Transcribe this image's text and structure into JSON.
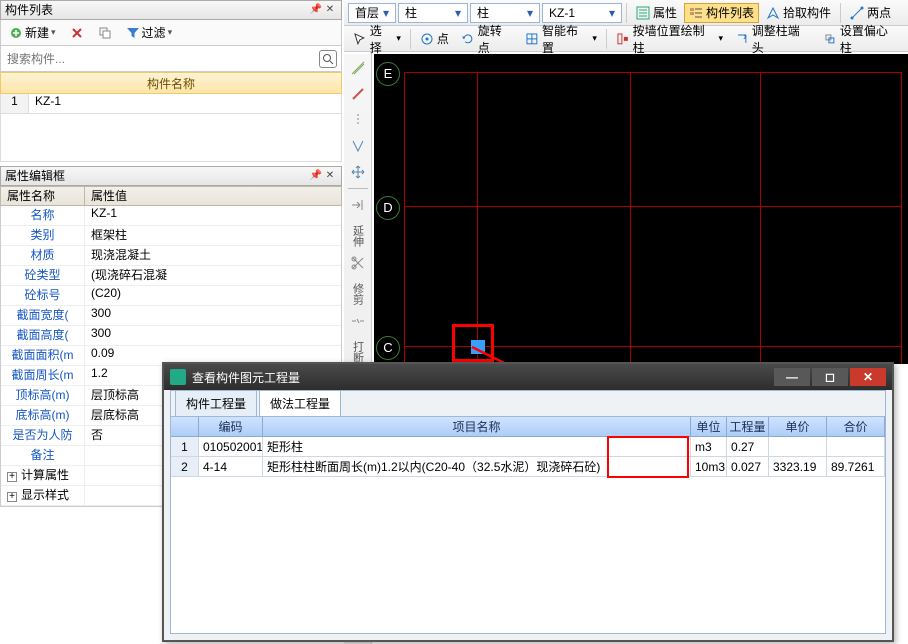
{
  "leftPanel": {
    "title": "构件列表",
    "newBtn": "新建",
    "filterBtn": "过滤",
    "searchPlaceholder": "搜索构件...",
    "listHeader": "构件名称",
    "rows": [
      {
        "num": "1",
        "name": "KZ-1"
      }
    ]
  },
  "propPanel": {
    "title": "属性编辑框",
    "headerName": "属性名称",
    "headerValue": "属性值",
    "rows": [
      {
        "k": "名称",
        "v": "KZ-1"
      },
      {
        "k": "类别",
        "v": "框架柱"
      },
      {
        "k": "材质",
        "v": "现浇混凝土"
      },
      {
        "k": "砼类型",
        "v": "(现浇碎石混凝"
      },
      {
        "k": "砼标号",
        "v": "(C20)"
      },
      {
        "k": "截面宽度(",
        "v": "300"
      },
      {
        "k": "截面高度(",
        "v": "300"
      },
      {
        "k": "截面面积(m",
        "v": "0.09"
      },
      {
        "k": "截面周长(m",
        "v": "1.2"
      },
      {
        "k": "顶标高(m)",
        "v": "层顶标高"
      },
      {
        "k": "底标高(m)",
        "v": "层底标高"
      },
      {
        "k": "是否为人防",
        "v": "否"
      },
      {
        "k": "备注",
        "v": ""
      }
    ],
    "expandRows": [
      {
        "label": "计算属性"
      },
      {
        "label": "显示样式"
      }
    ]
  },
  "topbar": {
    "combos": [
      "首层",
      "柱",
      "柱",
      "KZ-1"
    ],
    "btnProps": "属性",
    "btnList": "构件列表",
    "btnPick": "拾取构件",
    "btnTwoPoint": "两点",
    "row2": {
      "select": "选择",
      "point": "点",
      "rotPoint": "旋转点",
      "smart": "智能布置",
      "wallCol": "按墙位置绘制柱",
      "adjEnd": "调整柱端头",
      "offset": "设置偏心柱"
    }
  },
  "sideLabels": [
    "延伸",
    "修剪",
    "打断"
  ],
  "axis": {
    "E": "E",
    "D": "D",
    "C": "C"
  },
  "resultWin": {
    "title": "查看构件图元工程量",
    "tab1": "构件工程量",
    "tab2": "做法工程量",
    "head": {
      "code": "编码",
      "name": "项目名称",
      "unit": "单位",
      "qty": "工程量",
      "price": "单价",
      "total": "合价"
    },
    "rows": [
      {
        "num": "1",
        "code": "010502001",
        "name": "矩形柱",
        "unit": "m3",
        "qty": "0.27",
        "price": "",
        "total": ""
      },
      {
        "num": "2",
        "code": "4-14",
        "name": "矩形柱柱断面周长(m)1.2以内(C20-40（32.5水泥）现浇碎石砼)",
        "unit": "10m3",
        "qty": "0.027",
        "price": "3323.19",
        "total": "89.7261"
      }
    ]
  }
}
